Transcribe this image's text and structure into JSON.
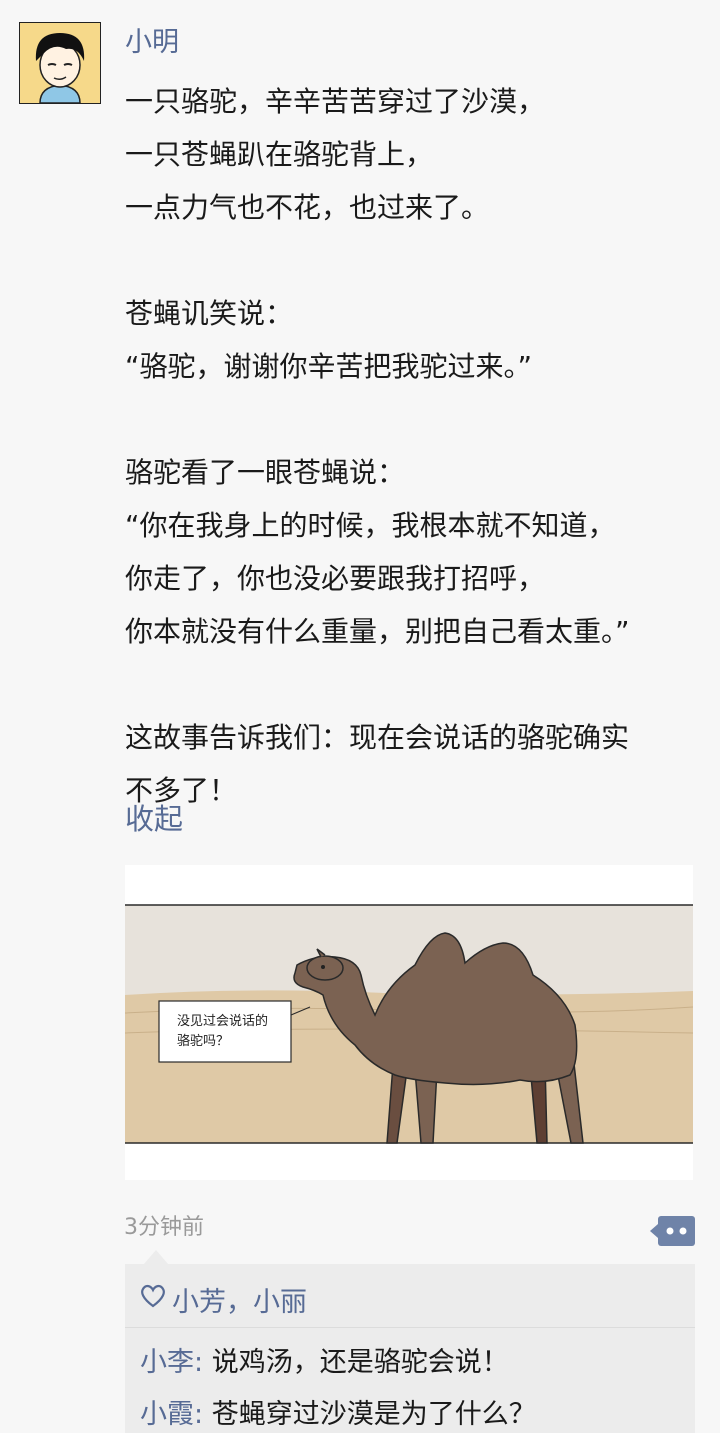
{
  "post": {
    "author": "小明",
    "text": "一只骆驼，辛辛苦苦穿过了沙漠，\n一只苍蝇趴在骆驼背上，\n一点力气也不花，也过来了。\n\n苍蝇讥笑说：\n“骆驼，谢谢你辛苦把我驼过来。”\n\n骆驼看了一眼苍蝇说：\n“你在我身上的时候，我根本就不知道，\n你走了，你也没必要跟我打招呼，\n你本就没有什么重量，别把自己看太重。”\n\n这故事告诉我们：现在会说话的骆驼确实\n不多了！",
    "collapse_label": "收起",
    "timestamp": "3分钟前"
  },
  "comic": {
    "bubble_text": "没见过会说话的\n骆驼吗？",
    "colors": {
      "sky": "#e7e2db",
      "sand": "#dfc9a6",
      "camel": "#7b6252",
      "outline": "#2a2a2a"
    }
  },
  "likes": {
    "names": "小芳，小丽"
  },
  "comments": [
    {
      "author": "小李",
      "separator": ":",
      "text": " 说鸡汤，还是骆驼会说！"
    },
    {
      "author": "小霞",
      "separator": ":",
      "text": " 苍蝇穿过沙漠是为了什么？"
    }
  ],
  "icons": {
    "avatar": "cartoon-boy-avatar",
    "like": "heart-outline-icon",
    "more": "comment-dots-icon"
  },
  "theme": {
    "link_color": "#576b95",
    "text_color": "#1a1a1a",
    "muted_color": "#9a9a9a"
  }
}
